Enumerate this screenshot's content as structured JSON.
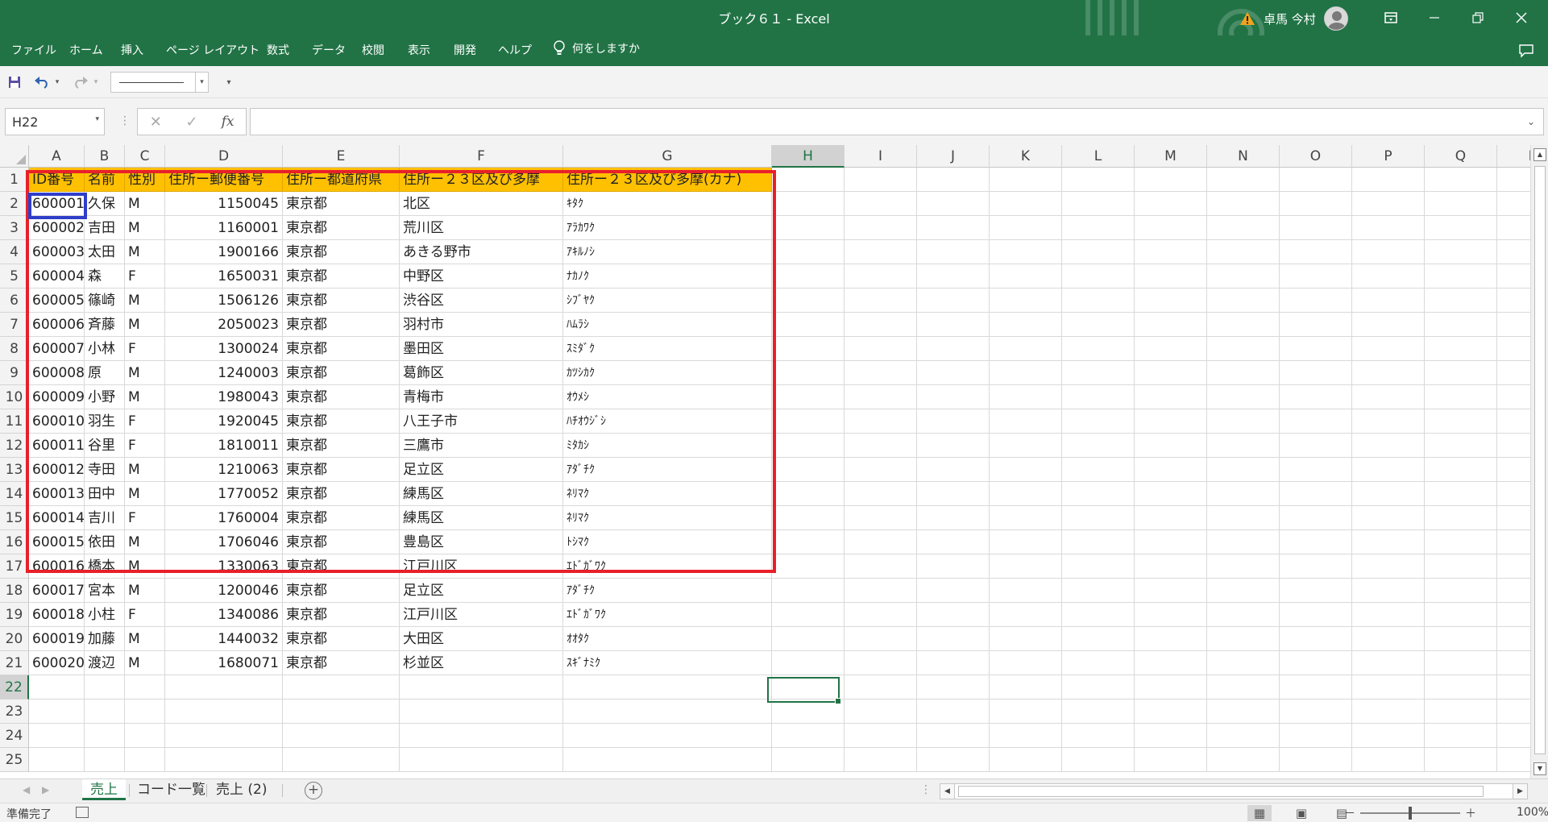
{
  "window": {
    "title": "ブック６１ - Excel",
    "user_name": "卓馬 今村",
    "warning_icon": "warning-icon",
    "buttons": [
      "ribbon-display-icon",
      "minimize-icon",
      "restore-icon",
      "close-icon"
    ]
  },
  "menu": {
    "items": [
      "ファイル",
      "ホーム",
      "挿入",
      "ページ レイアウト",
      "数式",
      "データ",
      "校閲",
      "表示",
      "開発",
      "ヘルプ"
    ],
    "tell_me": "何をしますか"
  },
  "formula_bar": {
    "name_box": "H22",
    "formula": "",
    "fx_label": "fx"
  },
  "columns": [
    "A",
    "B",
    "C",
    "D",
    "E",
    "F",
    "G",
    "H",
    "I",
    "J",
    "K",
    "L",
    "M",
    "N",
    "O",
    "P",
    "Q",
    "R"
  ],
  "rows": [
    "1",
    "2",
    "3",
    "4",
    "5",
    "6",
    "7",
    "8",
    "9",
    "10",
    "11",
    "12",
    "13",
    "14",
    "15",
    "16",
    "17",
    "18",
    "19",
    "20",
    "21",
    "22",
    "23",
    "24",
    "25"
  ],
  "selected_cell": {
    "column": "H",
    "row": "22"
  },
  "table": {
    "headers": [
      "ID番号",
      "名前",
      "性別",
      "住所ー郵便番号",
      "住所ー都道府県",
      "住所ー２３区及び多摩",
      "住所ー２３区及び多摩(カナ)"
    ],
    "rows": [
      [
        "600001",
        "久保",
        "M",
        "1150045",
        "東京都",
        "北区",
        "ｷﾀｸ"
      ],
      [
        "600002",
        "吉田",
        "M",
        "1160001",
        "東京都",
        "荒川区",
        "ｱﾗｶﾜｸ"
      ],
      [
        "600003",
        "太田",
        "M",
        "1900166",
        "東京都",
        "あきる野市",
        "ｱｷﾙﾉｼ"
      ],
      [
        "600004",
        "森",
        "F",
        "1650031",
        "東京都",
        "中野区",
        "ﾅｶﾉｸ"
      ],
      [
        "600005",
        "篠崎",
        "M",
        "1506126",
        "東京都",
        "渋谷区",
        "ｼﾌﾞﾔｸ"
      ],
      [
        "600006",
        "斉藤",
        "M",
        "2050023",
        "東京都",
        "羽村市",
        "ﾊﾑﾗｼ"
      ],
      [
        "600007",
        "小林",
        "F",
        "1300024",
        "東京都",
        "墨田区",
        "ｽﾐﾀﾞｸ"
      ],
      [
        "600008",
        "原",
        "M",
        "1240003",
        "東京都",
        "葛飾区",
        "ｶﾂｼｶｸ"
      ],
      [
        "600009",
        "小野",
        "M",
        "1980043",
        "東京都",
        "青梅市",
        "ｵｳﾒｼ"
      ],
      [
        "600010",
        "羽生",
        "F",
        "1920045",
        "東京都",
        "八王子市",
        "ﾊﾁｵｳｼﾞｼ"
      ],
      [
        "600011",
        "谷里",
        "F",
        "1810011",
        "東京都",
        "三鷹市",
        "ﾐﾀｶｼ"
      ],
      [
        "600012",
        "寺田",
        "M",
        "1210063",
        "東京都",
        "足立区",
        "ｱﾀﾞﾁｸ"
      ],
      [
        "600013",
        "田中",
        "M",
        "1770052",
        "東京都",
        "練馬区",
        "ﾈﾘﾏｸ"
      ],
      [
        "600014",
        "吉川",
        "F",
        "1760004",
        "東京都",
        "練馬区",
        "ﾈﾘﾏｸ"
      ],
      [
        "600015",
        "依田",
        "M",
        "1706046",
        "東京都",
        "豊島区",
        "ﾄｼﾏｸ"
      ],
      [
        "600016",
        "橋本",
        "M",
        "1330063",
        "東京都",
        "江戸川区",
        "ｴﾄﾞｶﾞﾜｸ"
      ],
      [
        "600017",
        "宮本",
        "M",
        "1200046",
        "東京都",
        "足立区",
        "ｱﾀﾞﾁｸ"
      ],
      [
        "600018",
        "小柱",
        "F",
        "1340086",
        "東京都",
        "江戸川区",
        "ｴﾄﾞｶﾞﾜｸ"
      ],
      [
        "600019",
        "加藤",
        "M",
        "1440032",
        "東京都",
        "大田区",
        "ｵｵﾀｸ"
      ],
      [
        "600020",
        "渡辺",
        "M",
        "1680071",
        "東京都",
        "杉並区",
        "ｽｷﾞﾅﾐｸ"
      ]
    ]
  },
  "sheet_tabs": [
    "売上",
    "コード一覧",
    "売上 (2)"
  ],
  "active_sheet": "売上",
  "status": {
    "ready": "準備完了",
    "zoom": "100%",
    "zoom_minus": "－",
    "zoom_plus": "＋"
  },
  "colors": {
    "excel_green": "#217346",
    "header_fill": "#ffc000",
    "red_outline": "#e8202a",
    "blue_outline": "#2e3ec9"
  }
}
